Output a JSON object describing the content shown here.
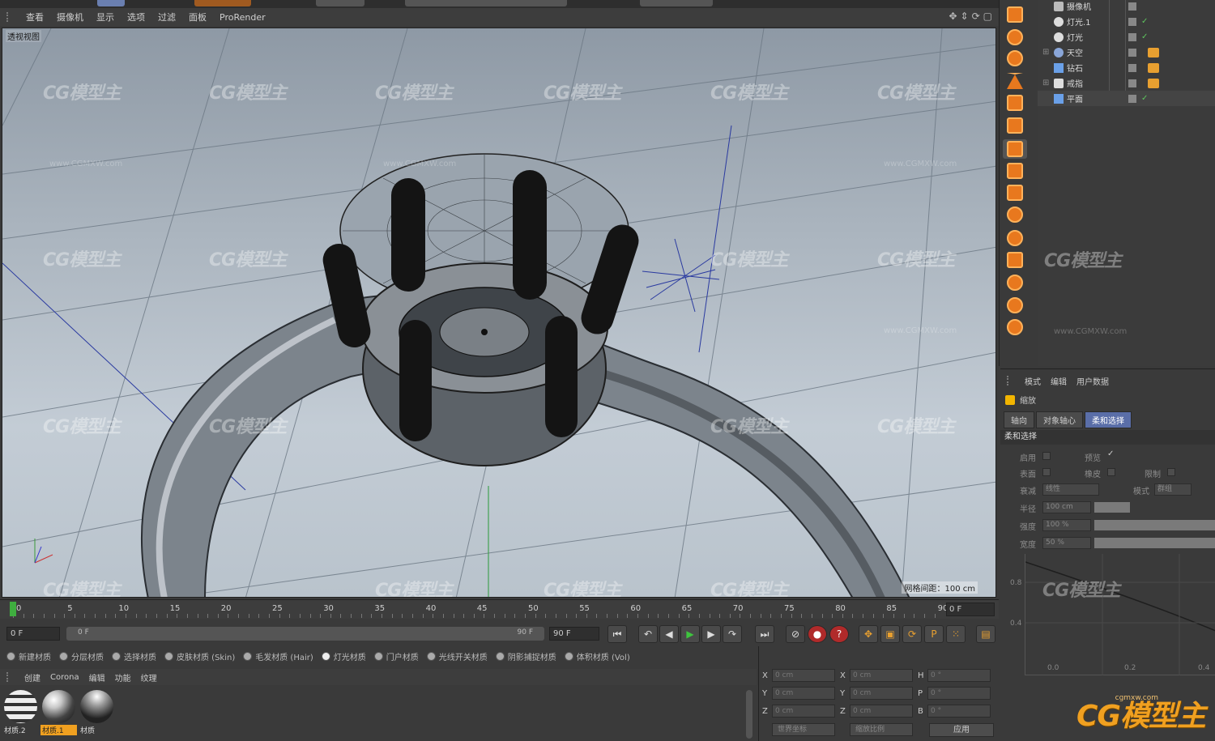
{
  "viewport": {
    "menu": [
      "查看",
      "摄像机",
      "显示",
      "选项",
      "过滤",
      "面板",
      "ProRender"
    ],
    "label": "透视视图",
    "scale": "网格间距：100 cm",
    "watermark": "CG模型主",
    "watermark_url": "www.CGMXW.com"
  },
  "objects": [
    {
      "name": "摄像机"
    },
    {
      "name": "灯光.1"
    },
    {
      "name": "灯光"
    },
    {
      "name": "天空"
    },
    {
      "name": "钻石"
    },
    {
      "name": "戒指"
    },
    {
      "name": "平面"
    }
  ],
  "attributes": {
    "menu": [
      "模式",
      "编辑",
      "用户数据"
    ],
    "title": "缩放",
    "tabs": [
      "轴向",
      "对象轴心",
      "柔和选择"
    ],
    "section": "柔和选择",
    "enable": "启用",
    "preview": "预览",
    "surface": "表面",
    "rubber": "橡皮",
    "restrict": "限制",
    "falloff": "衰减",
    "falloff_value": "线性",
    "mode": "模式",
    "mode_value": "群组",
    "radius": "半径",
    "radius_value": "100 cm",
    "strength": "强度",
    "strength_value": "100 %",
    "width": "宽度",
    "width_value": "50 %",
    "graph_y": [
      "0.8",
      "0.4"
    ],
    "graph_x": [
      "0.0",
      "0.2",
      "0.4"
    ]
  },
  "timeline": {
    "ticks": [
      "0",
      "5",
      "10",
      "15",
      "20",
      "25",
      "30",
      "35",
      "40",
      "45",
      "50",
      "55",
      "60",
      "65",
      "70",
      "75",
      "80",
      "85",
      "90"
    ],
    "end_field": "0 F"
  },
  "playback": {
    "start": "0 F",
    "slider_start": "0 F",
    "slider_end": "90 F",
    "end": "90 F"
  },
  "material_buttons": [
    "新建材质",
    "分层材质",
    "选择材质",
    "皮肤材质 (Skin)",
    "毛发材质 (Hair)",
    "灯光材质",
    "门户材质",
    "光线开关材质",
    "阴影捕捉材质",
    "体积材质 (Vol)"
  ],
  "material_menu": [
    "创建",
    "Corona",
    "编辑",
    "功能",
    "纹理"
  ],
  "materials": [
    {
      "name": "材质.2"
    },
    {
      "name": "材质.1"
    },
    {
      "name": "材质"
    }
  ],
  "coords": {
    "rows": [
      {
        "a": "X",
        "v1": "0 cm",
        "b": "X",
        "v2": "0 cm",
        "c": "H",
        "v3": "0 °"
      },
      {
        "a": "Y",
        "v1": "0 cm",
        "b": "Y",
        "v2": "0 cm",
        "c": "P",
        "v3": "0 °"
      },
      {
        "a": "Z",
        "v1": "0 cm",
        "b": "Z",
        "v2": "0 cm",
        "c": "B",
        "v3": "0 °"
      }
    ],
    "mode1": "世界坐标",
    "mode2": "缩放比例",
    "apply": "应用"
  },
  "logo": "CG模型主",
  "logo_url": "cgmxw.com",
  "colors": {
    "accent": "#f0a020",
    "play": "#3ec43e",
    "tool": "#e8781e"
  }
}
